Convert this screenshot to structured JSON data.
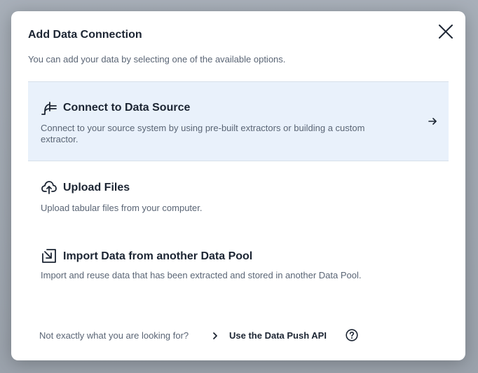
{
  "dialog": {
    "title": "Add Data Connection",
    "subtitle": "You can add your data by selecting one of the available options."
  },
  "options": [
    {
      "icon": "plug-icon",
      "title": "Connect to Data Source",
      "description": "Connect to your source system by using pre-built extractors or building a custom extractor.",
      "selected": true
    },
    {
      "icon": "cloud-upload-icon",
      "title": "Upload Files",
      "description": "Upload tabular files from your computer.",
      "selected": false
    },
    {
      "icon": "import-icon",
      "title": "Import Data from another Data Pool",
      "description": "Import and reuse data that has been extracted and stored in another Data Pool.",
      "selected": false
    }
  ],
  "footer": {
    "question": "Not exactly what you are looking for?",
    "link_label": "Use the Data Push API"
  },
  "colors": {
    "selected_background": "#e9f1fb",
    "text_primary": "#1c2533",
    "text_secondary": "#5a6575"
  }
}
